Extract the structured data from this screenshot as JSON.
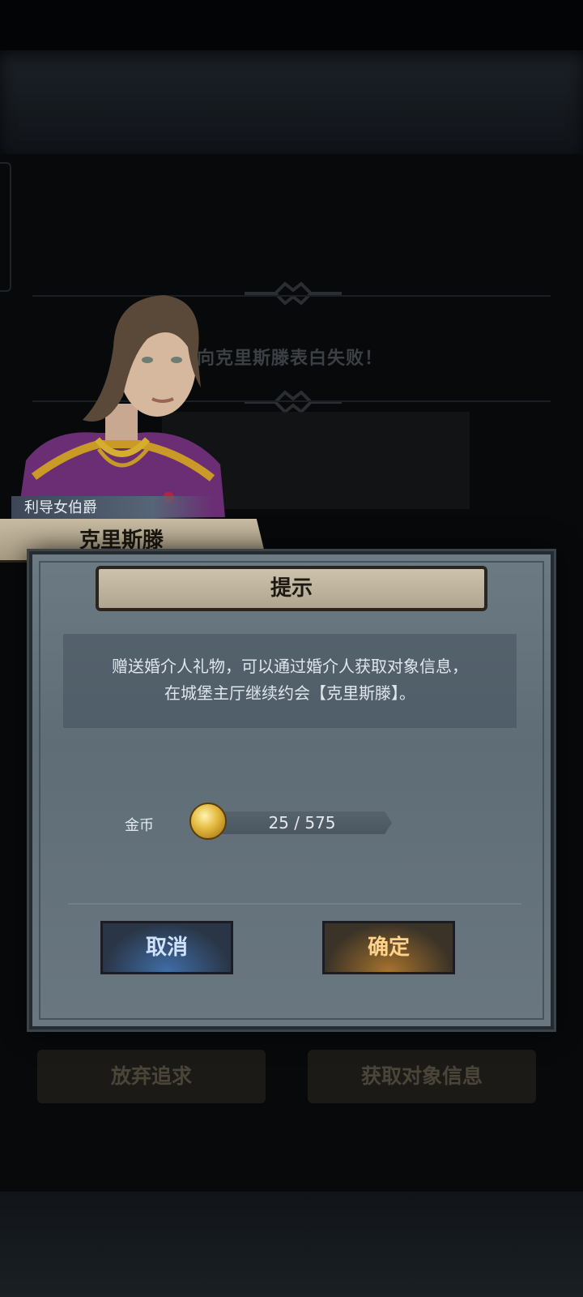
{
  "background": {
    "ghost_message": "卄向克里斯滕表白失败！",
    "buttons": {
      "give_up": "放弃追求",
      "get_info": "获取对象信息"
    }
  },
  "character": {
    "title": "利导女伯爵",
    "name": "克里斯滕"
  },
  "dialog": {
    "title": "提示",
    "message_line1": "赠送婚介人礼物，可以通过婚介人获取对象信息，",
    "message_line2": "在城堡主厅继续约会【克里斯滕】。",
    "currency_label": "金币",
    "currency_icon": "gold-coin-icon",
    "currency_value": "25 / 575",
    "currency_progress": 0.0435,
    "cancel_label": "取消",
    "confirm_label": "确定"
  },
  "colors": {
    "cancel_glow": "#3f6ea8",
    "confirm_glow": "#a8732c",
    "parchment": "#c7bba3"
  }
}
